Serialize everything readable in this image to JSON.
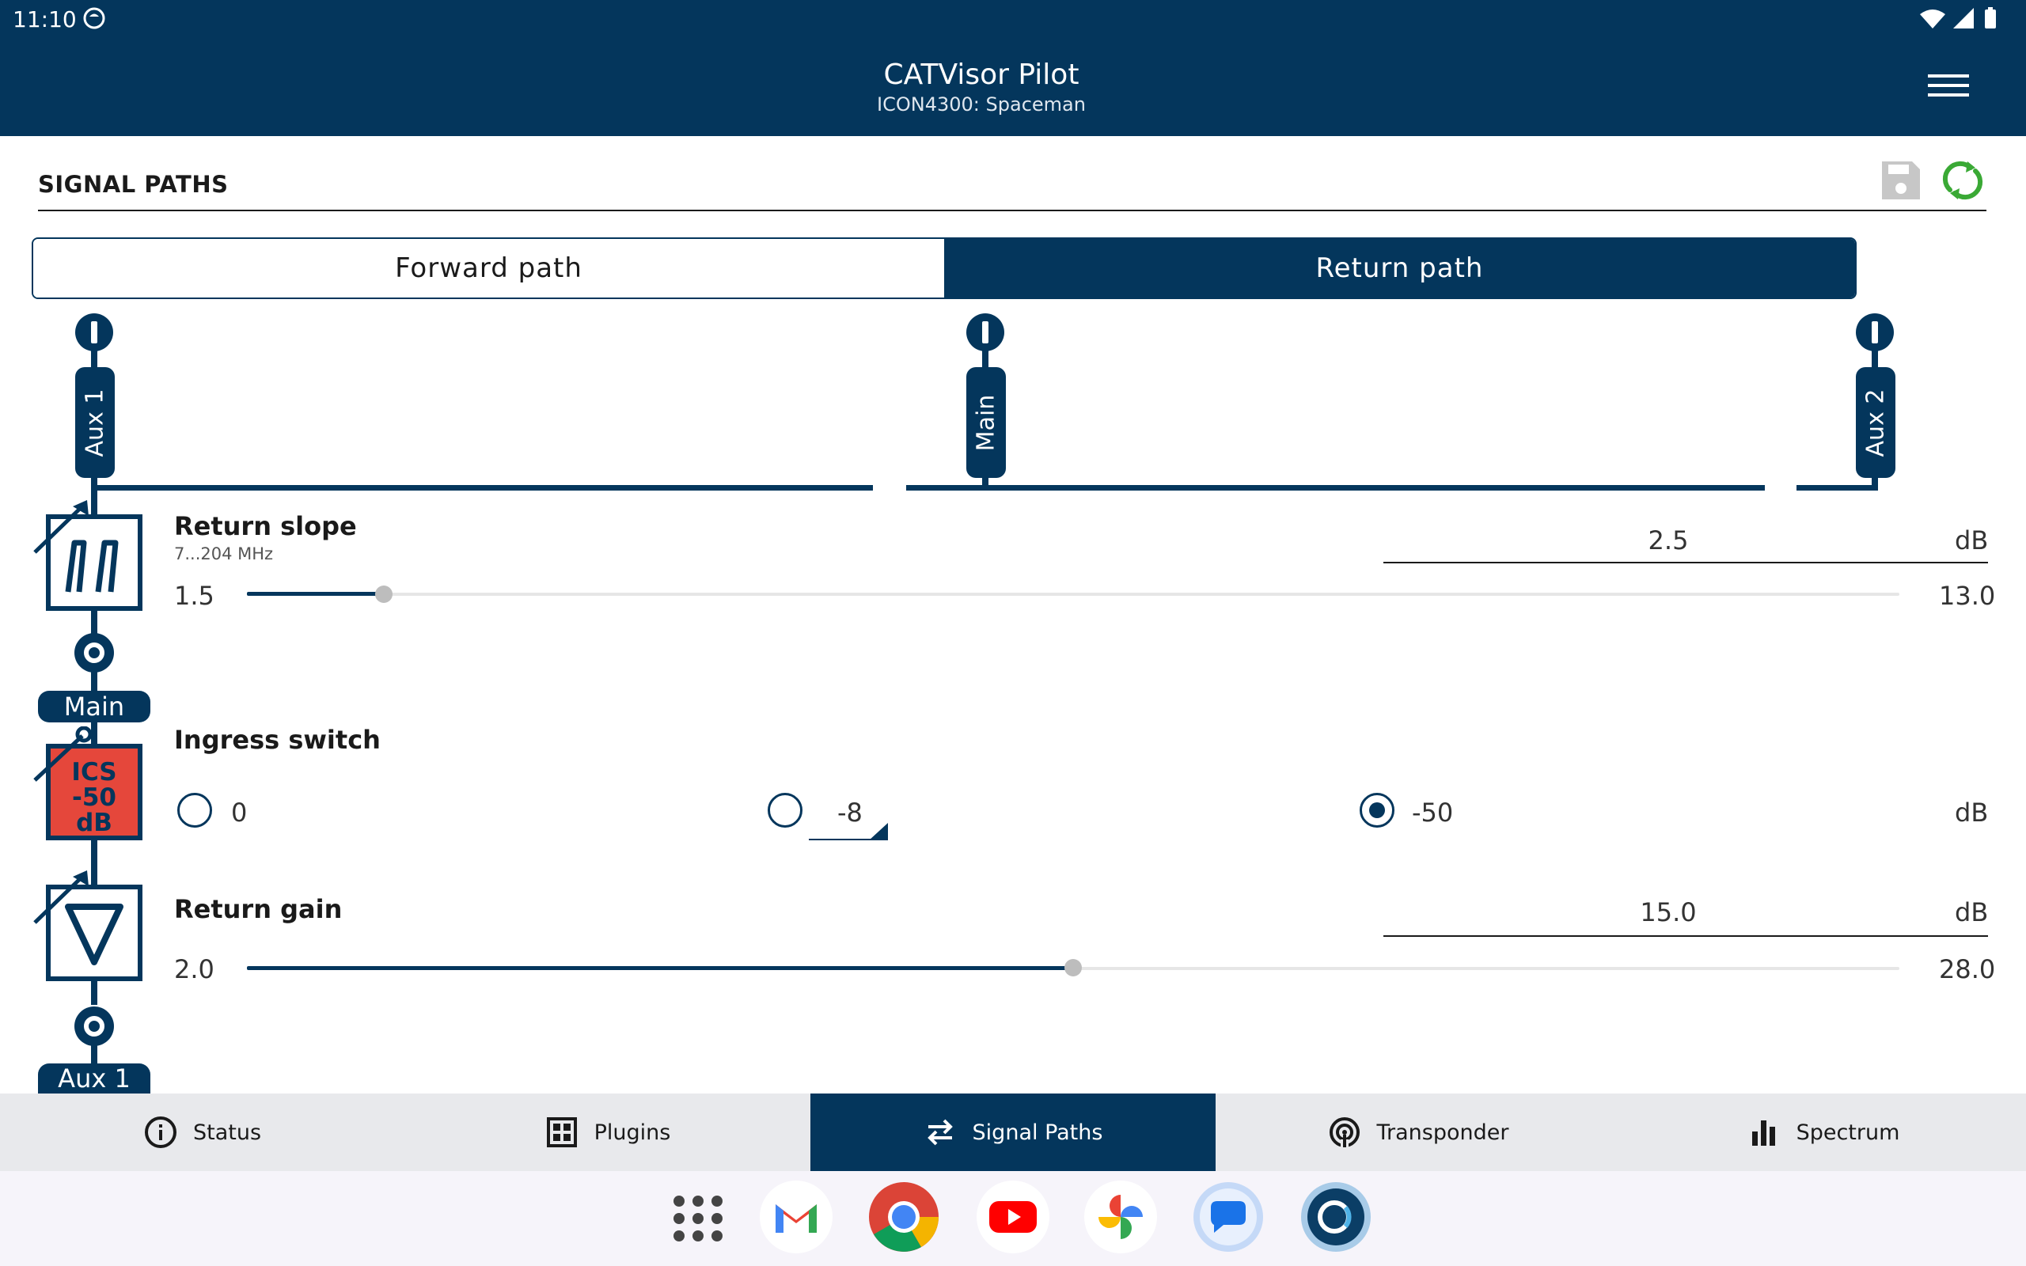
{
  "status_bar": {
    "time": "11:10"
  },
  "app": {
    "title": "CATVisor Pilot",
    "subtitle": "ICON4300: Spaceman"
  },
  "section": {
    "title": "SIGNAL PATHS"
  },
  "tabs": [
    {
      "label": "Forward path",
      "active": false
    },
    {
      "label": "Return path",
      "active": true
    }
  ],
  "diagram": {
    "ports_top": [
      "Aux 1",
      "Main",
      "Aux 2"
    ],
    "node_main_label": "Main",
    "node_aux1_label": "Aux 1",
    "ics_block": {
      "line1": "ICS",
      "line2": "-50",
      "line3": "dB",
      "color": "#e5473b"
    }
  },
  "return_slope": {
    "label": "Return slope",
    "range_text": "7...204 MHz",
    "value": "2.5",
    "unit": "dB",
    "min": "1.5",
    "max": "13.0",
    "fraction": 0.083
  },
  "ingress_switch": {
    "label": "Ingress switch",
    "options": [
      {
        "label": "0",
        "checked": false
      },
      {
        "label": "-8",
        "checked": false
      },
      {
        "label": "-50",
        "checked": true
      }
    ],
    "unit": "dB"
  },
  "return_gain": {
    "label": "Return gain",
    "value": "15.0",
    "unit": "dB",
    "min": "2.0",
    "max": "28.0",
    "fraction": 0.5
  },
  "bottom_nav": [
    {
      "label": "Status",
      "icon": "info-icon",
      "active": false
    },
    {
      "label": "Plugins",
      "icon": "plugins-icon",
      "active": false
    },
    {
      "label": "Signal Paths",
      "icon": "swap-arrows-icon",
      "active": true
    },
    {
      "label": "Transponder",
      "icon": "transponder-icon",
      "active": false
    },
    {
      "label": "Spectrum",
      "icon": "bar-chart-icon",
      "active": false
    }
  ],
  "dock": [
    "app-drawer",
    "gmail",
    "chrome",
    "youtube",
    "photos",
    "messages",
    "catvisor"
  ],
  "colors": {
    "primary": "#04365c",
    "accent_green": "#3aa935",
    "ics_red": "#e5473b"
  }
}
